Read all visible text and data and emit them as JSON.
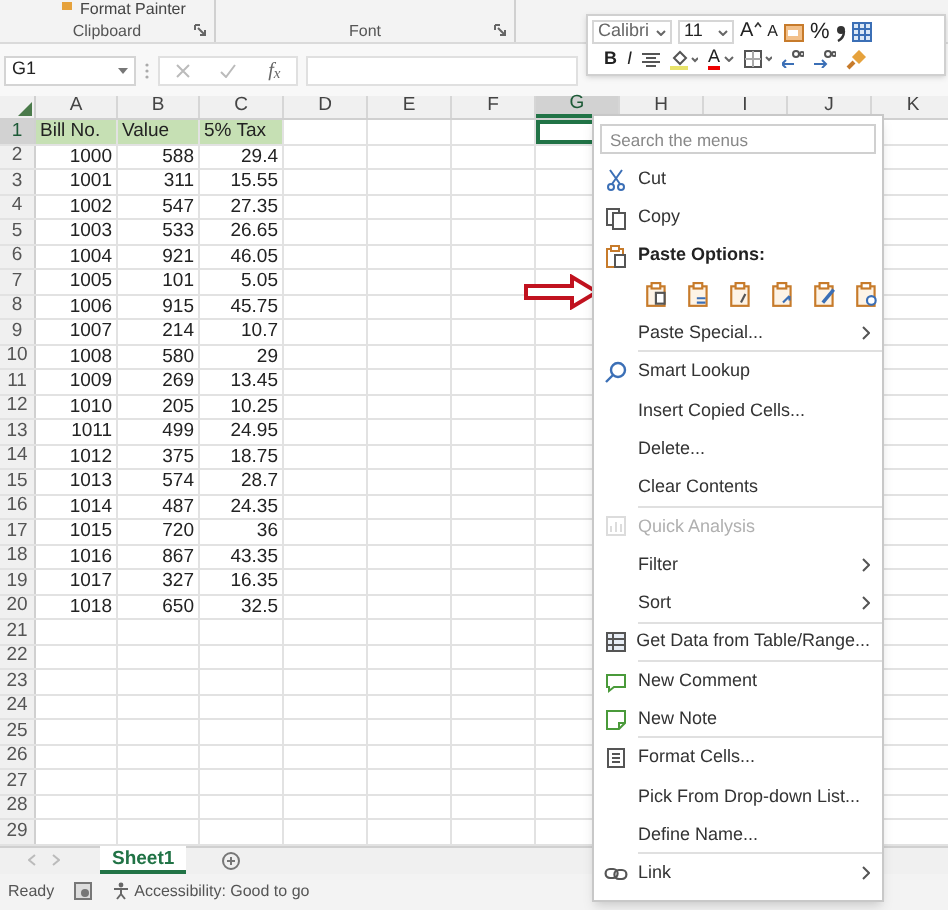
{
  "ribbon": {
    "partial_command": "Format Painter",
    "groups": [
      {
        "label": "Clipboard"
      },
      {
        "label": "Font"
      }
    ]
  },
  "formula_bar": {
    "name_box": "G1",
    "function_label": "f$_{x}$"
  },
  "columns": [
    {
      "label": "A",
      "selected": false
    },
    {
      "label": "B",
      "selected": false
    },
    {
      "label": "C",
      "selected": false
    },
    {
      "label": "D",
      "selected": false
    },
    {
      "label": "E",
      "selected": false
    },
    {
      "label": "F",
      "selected": false
    },
    {
      "label": "G",
      "selected": true
    },
    {
      "label": "H",
      "selected": false
    },
    {
      "label": "I",
      "selected": false
    },
    {
      "label": "J",
      "selected": false
    },
    {
      "label": "K",
      "selected": false
    }
  ],
  "rows": [
    {
      "number": "1",
      "selected": true,
      "kind": "header",
      "cells": [
        "Bill No.",
        "Value",
        "5% Tax"
      ]
    },
    {
      "number": "2",
      "selected": false,
      "kind": "data",
      "cells": [
        "1000",
        "588",
        "29.4"
      ]
    },
    {
      "number": "3",
      "selected": false,
      "kind": "data",
      "cells": [
        "1001",
        "311",
        "15.55"
      ]
    },
    {
      "number": "4",
      "selected": false,
      "kind": "data",
      "cells": [
        "1002",
        "547",
        "27.35"
      ]
    },
    {
      "number": "5",
      "selected": false,
      "kind": "data",
      "cells": [
        "1003",
        "533",
        "26.65"
      ]
    },
    {
      "number": "6",
      "selected": false,
      "kind": "data",
      "cells": [
        "1004",
        "921",
        "46.05"
      ]
    },
    {
      "number": "7",
      "selected": false,
      "kind": "data",
      "cells": [
        "1005",
        "101",
        "5.05"
      ]
    },
    {
      "number": "8",
      "selected": false,
      "kind": "data",
      "cells": [
        "1006",
        "915",
        "45.75"
      ]
    },
    {
      "number": "9",
      "selected": false,
      "kind": "data",
      "cells": [
        "1007",
        "214",
        "10.7"
      ]
    },
    {
      "number": "10",
      "selected": false,
      "kind": "data",
      "cells": [
        "1008",
        "580",
        "29"
      ]
    },
    {
      "number": "11",
      "selected": false,
      "kind": "data",
      "cells": [
        "1009",
        "269",
        "13.45"
      ]
    },
    {
      "number": "12",
      "selected": false,
      "kind": "data",
      "cells": [
        "1010",
        "205",
        "10.25"
      ]
    },
    {
      "number": "13",
      "selected": false,
      "kind": "data",
      "cells": [
        "1011",
        "499",
        "24.95"
      ]
    },
    {
      "number": "14",
      "selected": false,
      "kind": "data",
      "cells": [
        "1012",
        "375",
        "18.75"
      ]
    },
    {
      "number": "15",
      "selected": false,
      "kind": "data",
      "cells": [
        "1013",
        "574",
        "28.7"
      ]
    },
    {
      "number": "16",
      "selected": false,
      "kind": "data",
      "cells": [
        "1014",
        "487",
        "24.35"
      ]
    },
    {
      "number": "17",
      "selected": false,
      "kind": "data",
      "cells": [
        "1015",
        "720",
        "36"
      ]
    },
    {
      "number": "18",
      "selected": false,
      "kind": "data",
      "cells": [
        "1016",
        "867",
        "43.35"
      ]
    },
    {
      "number": "19",
      "selected": false,
      "kind": "data",
      "cells": [
        "1017",
        "327",
        "16.35"
      ]
    },
    {
      "number": "20",
      "selected": false,
      "kind": "data",
      "cells": [
        "1018",
        "650",
        "32.5"
      ]
    },
    {
      "number": "21",
      "selected": false,
      "kind": "empty",
      "cells": []
    },
    {
      "number": "22",
      "selected": false,
      "kind": "empty",
      "cells": []
    },
    {
      "number": "23",
      "selected": false,
      "kind": "empty",
      "cells": []
    },
    {
      "number": "24",
      "selected": false,
      "kind": "empty",
      "cells": []
    },
    {
      "number": "25",
      "selected": false,
      "kind": "empty",
      "cells": []
    },
    {
      "number": "26",
      "selected": false,
      "kind": "empty",
      "cells": []
    },
    {
      "number": "27",
      "selected": false,
      "kind": "empty",
      "cells": []
    },
    {
      "number": "28",
      "selected": false,
      "kind": "empty",
      "cells": []
    },
    {
      "number": "29",
      "selected": false,
      "kind": "empty",
      "cells": []
    }
  ],
  "mini_toolbar": {
    "font": "Calibri",
    "size": "11",
    "grow_font": "A",
    "shrink_font": "A",
    "percent": "%",
    "bold": "B",
    "italic": "I",
    "font_color": "A"
  },
  "context_menu": {
    "search_placeholder": "Search the menus",
    "items": [
      {
        "kind": "cut",
        "label": "Cut",
        "submenu": false,
        "disabled": false,
        "separator": false
      },
      {
        "kind": "copy",
        "label": "Copy",
        "submenu": false,
        "disabled": false,
        "separator": false
      },
      {
        "kind": "paste_heading",
        "label": "Paste Options:",
        "separator": false
      },
      {
        "kind": "paste_options",
        "separator": false
      },
      {
        "kind": "plain",
        "label": "Paste Special...",
        "submenu": true,
        "disabled": false,
        "separator": true
      },
      {
        "kind": "lookup",
        "label": "Smart Lookup",
        "submenu": false,
        "disabled": false,
        "separator": false
      },
      {
        "kind": "plain",
        "label": "Insert Copied Cells...",
        "submenu": false,
        "disabled": false,
        "separator": false
      },
      {
        "kind": "plain",
        "label": "Delete...",
        "submenu": false,
        "disabled": false,
        "separator": false
      },
      {
        "kind": "plain",
        "label": "Clear Contents",
        "submenu": false,
        "disabled": false,
        "separator": true
      },
      {
        "kind": "analysis",
        "label": "Quick Analysis",
        "submenu": false,
        "disabled": true,
        "separator": false
      },
      {
        "kind": "plain",
        "label": "Filter",
        "submenu": true,
        "disabled": false,
        "separator": false
      },
      {
        "kind": "plain",
        "label": "Sort",
        "submenu": true,
        "disabled": false,
        "separator": true
      },
      {
        "kind": "table",
        "label": "Get Data from Table/Range...",
        "submenu": false,
        "disabled": false,
        "separator": true
      },
      {
        "kind": "comment",
        "label": "New Comment",
        "submenu": false,
        "disabled": false,
        "separator": false
      },
      {
        "kind": "note",
        "label": "New Note",
        "submenu": false,
        "disabled": false,
        "separator": true
      },
      {
        "kind": "format",
        "label": "Format Cells...",
        "submenu": false,
        "disabled": false,
        "separator": false
      },
      {
        "kind": "plain",
        "label": "Pick From Drop-down List...",
        "submenu": false,
        "disabled": false,
        "separator": false
      },
      {
        "kind": "plain",
        "label": "Define Name...",
        "submenu": false,
        "disabled": false,
        "separator": true
      },
      {
        "kind": "link",
        "label": "Link",
        "submenu": true,
        "disabled": false,
        "separator": false
      }
    ]
  },
  "sheet_tabs": [
    {
      "label": "Sheet1",
      "selected": true
    }
  ],
  "status_bar": {
    "mode": "Ready",
    "accessibility": "Accessibility: Good to go"
  }
}
